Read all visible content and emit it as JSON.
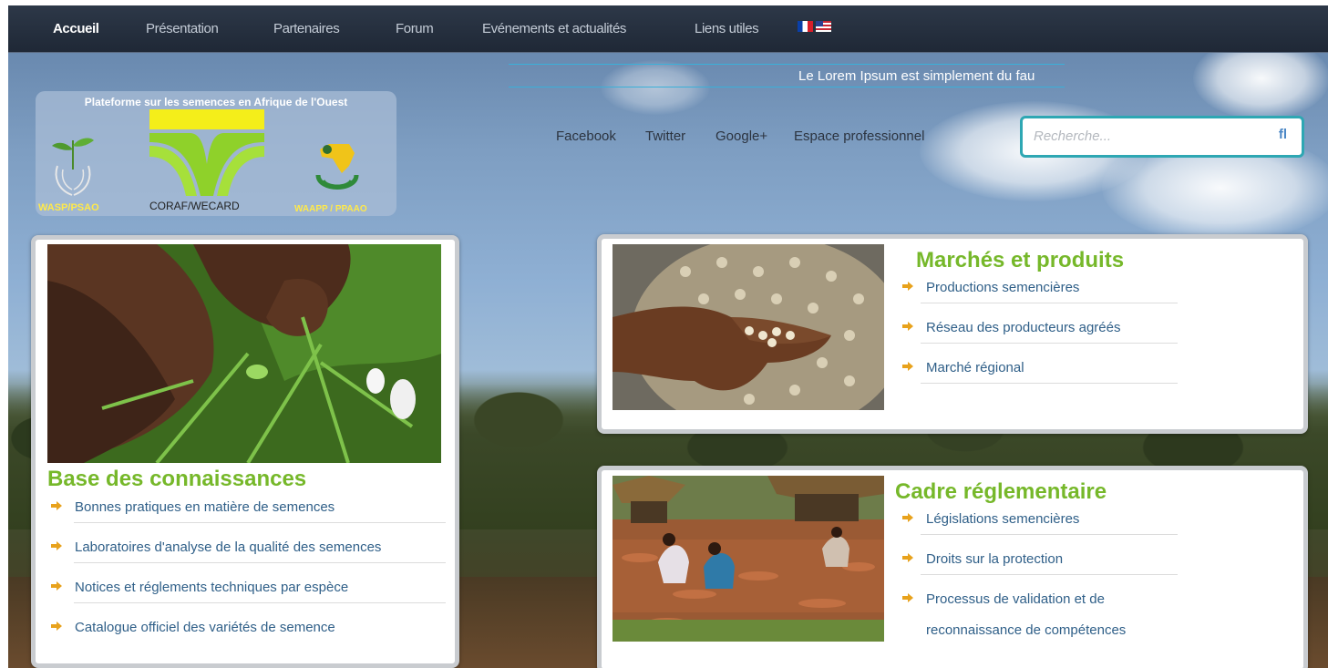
{
  "nav": {
    "items": [
      {
        "label": "Accueil",
        "active": true
      },
      {
        "label": "Présentation"
      },
      {
        "label": "Partenaires"
      },
      {
        "label": "Forum"
      },
      {
        "label": "Evénements et actualités"
      },
      {
        "label": "Liens utiles"
      }
    ],
    "languages": [
      "french-flag-icon",
      "us-flag-icon"
    ]
  },
  "ticker": {
    "text": "Le Lorem Ipsum est simplement du fau"
  },
  "logos": {
    "title": "Plateforme sur les semences en Afrique de l'Ouest",
    "left_label": "WASP/PSAO",
    "center_label": "CORAF/WECARD",
    "right_label": "WAAPP / PPAAO"
  },
  "social": {
    "facebook": "Facebook",
    "twitter": "Twitter",
    "google": "Google+",
    "pro": "Espace professionnel"
  },
  "search": {
    "placeholder": "Recherche...",
    "icon": "fl"
  },
  "cards": {
    "base": {
      "title": "Base des connaissances",
      "items": [
        "Bonnes pratiques en matière de semences",
        "Laboratoires d'analyse de la qualité des semences",
        "Notices et réglements techniques par espèce",
        "Catalogue officiel des variétés de semence"
      ]
    },
    "markets": {
      "title": "Marchés et produits",
      "items": [
        "Productions semencières",
        "Réseau des producteurs agréés",
        "Marché régional"
      ]
    },
    "reg": {
      "title": "Cadre réglementaire",
      "items": [
        "Législations semencières",
        "Droits sur la protection",
        "Processus de validation et de",
        "reconnaissance de compétences"
      ]
    }
  },
  "colors": {
    "accent_green": "#76b82a",
    "link_blue": "#2f5f88",
    "arrow_orange": "#e8a21c",
    "search_border": "#2ea7b3"
  }
}
